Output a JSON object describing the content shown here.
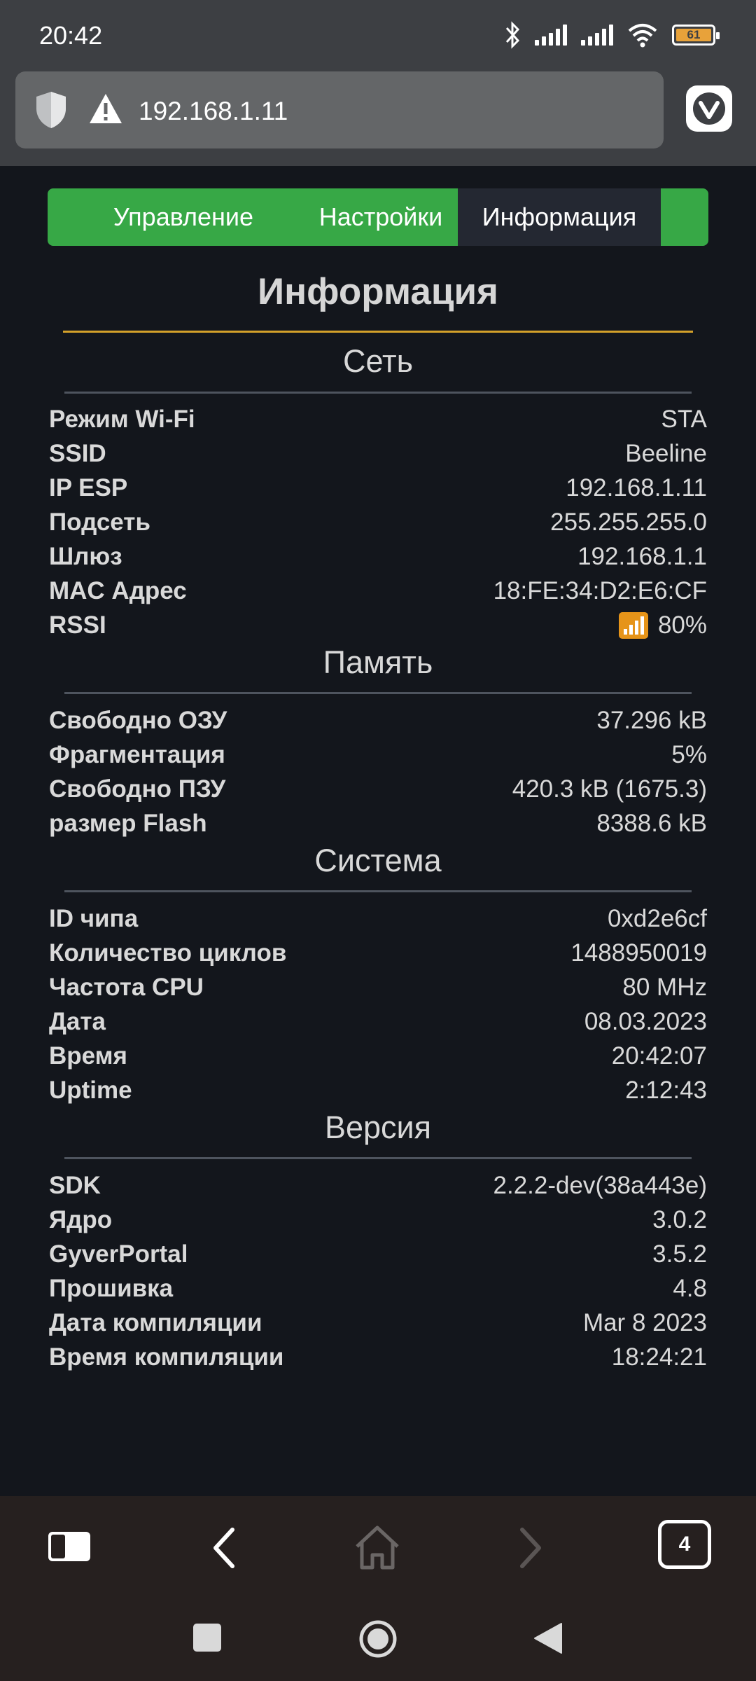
{
  "status_bar": {
    "time": "20:42",
    "battery": "61"
  },
  "browser": {
    "url": "192.168.1.11",
    "tab_count": "4"
  },
  "tabs": [
    {
      "label": "Управление"
    },
    {
      "label": "Настройки"
    },
    {
      "label": "Информация"
    }
  ],
  "page_title": "Информация",
  "sections": {
    "network": {
      "title": "Сеть",
      "rows": [
        {
          "key": "Режим Wi-Fi",
          "value": "STA"
        },
        {
          "key": "SSID",
          "value": "Beeline"
        },
        {
          "key": "IP ESP",
          "value": "192.168.1.11"
        },
        {
          "key": "Подсеть",
          "value": "255.255.255.0"
        },
        {
          "key": "Шлюз",
          "value": "192.168.1.1"
        },
        {
          "key": "MAC Адрес",
          "value": "18:FE:34:D2:E6:CF"
        },
        {
          "key": "RSSI",
          "value": "80%"
        }
      ]
    },
    "memory": {
      "title": "Память",
      "rows": [
        {
          "key": "Свободно ОЗУ",
          "value": "37.296 kB"
        },
        {
          "key": "Фрагментация",
          "value": "5%"
        },
        {
          "key": "Свободно ПЗУ",
          "value": "420.3 kB (1675.3)"
        },
        {
          "key": "размер Flash",
          "value": "8388.6 kB"
        }
      ]
    },
    "system": {
      "title": "Система",
      "rows": [
        {
          "key": "ID чипа",
          "value": "0xd2e6cf"
        },
        {
          "key": "Количество циклов",
          "value": "1488950019"
        },
        {
          "key": "Частота CPU",
          "value": "80 MHz"
        },
        {
          "key": "Дата",
          "value": "08.03.2023"
        },
        {
          "key": "Время",
          "value": "20:42:07"
        },
        {
          "key": "Uptime",
          "value": "2:12:43"
        }
      ]
    },
    "version": {
      "title": "Версия",
      "rows": [
        {
          "key": "SDK",
          "value": "2.2.2-dev(38a443e)"
        },
        {
          "key": "Ядро",
          "value": "3.0.2"
        },
        {
          "key": "GyverPortal",
          "value": "3.5.2"
        },
        {
          "key": "Прошивка",
          "value": "4.8"
        },
        {
          "key": "Дата компиляции",
          "value": "Mar 8 2023"
        },
        {
          "key": "Время компиляции",
          "value": "18:24:21"
        }
      ]
    }
  }
}
